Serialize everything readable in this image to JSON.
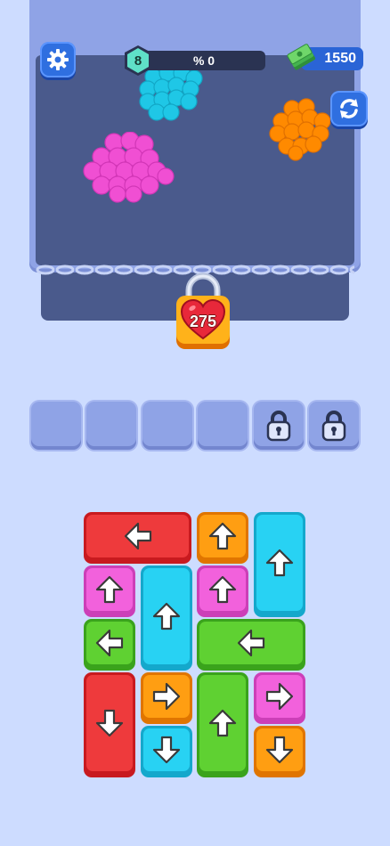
{
  "hud": {
    "level": "8",
    "progress_text": "% 0",
    "progress": 0,
    "money": "1550",
    "settings_icon": "gear-icon",
    "refresh_icon": "refresh-icon",
    "money_icon": "cash-stack-icon"
  },
  "lock": {
    "count": "275",
    "icon": "heart-padlock-icon"
  },
  "blobs": [
    {
      "color": "#1fc7e6",
      "name": "cyan-blob"
    },
    {
      "color": "#ff8a00",
      "name": "orange-blob"
    },
    {
      "color": "#f04fd3",
      "name": "pink-blob"
    }
  ],
  "slots": [
    {
      "state": "empty"
    },
    {
      "state": "empty"
    },
    {
      "state": "empty"
    },
    {
      "state": "empty"
    },
    {
      "state": "locked",
      "icon": "padlock-icon"
    },
    {
      "state": "locked",
      "icon": "padlock-icon"
    }
  ],
  "blocks": [
    {
      "color": "red",
      "direction": "left"
    },
    {
      "color": "orange",
      "direction": "up"
    },
    {
      "color": "cyan",
      "direction": "up"
    },
    {
      "color": "pink",
      "direction": "up"
    },
    {
      "color": "cyan",
      "direction": "up"
    },
    {
      "color": "pink",
      "direction": "up"
    },
    {
      "color": "green",
      "direction": "left"
    },
    {
      "color": "green",
      "direction": "left"
    },
    {
      "color": "red",
      "direction": "down"
    },
    {
      "color": "orange",
      "direction": "right"
    },
    {
      "color": "green",
      "direction": "up"
    },
    {
      "color": "pink",
      "direction": "right"
    },
    {
      "color": "cyan",
      "direction": "down"
    },
    {
      "color": "orange",
      "direction": "down"
    }
  ]
}
